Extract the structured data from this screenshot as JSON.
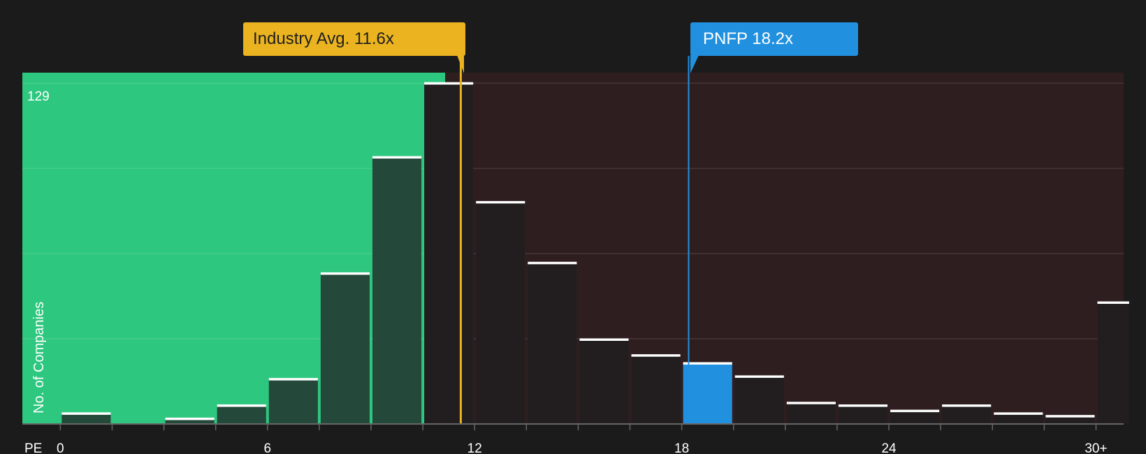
{
  "chart_data": {
    "type": "bar",
    "metric_label": "PE",
    "ylabel": "No. of Companies",
    "ymax_label": "129",
    "ylim": [
      0,
      133
    ],
    "xlim": [
      -1.1,
      30.8
    ],
    "x_ticks": [
      {
        "value": 0,
        "label": "0"
      },
      {
        "value": 6,
        "label": "6"
      },
      {
        "value": 12,
        "label": "12"
      },
      {
        "value": 18,
        "label": "18"
      },
      {
        "value": 24,
        "label": "24"
      },
      {
        "value": 30,
        "label": "30+"
      }
    ],
    "bins": [
      {
        "from": 0.0,
        "to": 1.5,
        "value": 4
      },
      {
        "from": 1.5,
        "to": 3.0,
        "value": 0
      },
      {
        "from": 3.0,
        "to": 4.5,
        "value": 2
      },
      {
        "from": 4.5,
        "to": 6.0,
        "value": 7
      },
      {
        "from": 6.0,
        "to": 7.5,
        "value": 17
      },
      {
        "from": 7.5,
        "to": 9.0,
        "value": 57
      },
      {
        "from": 9.0,
        "to": 10.5,
        "value": 101
      },
      {
        "from": 10.5,
        "to": 12.0,
        "value": 129
      },
      {
        "from": 12.0,
        "to": 13.5,
        "value": 84
      },
      {
        "from": 13.5,
        "to": 15.0,
        "value": 61
      },
      {
        "from": 15.0,
        "to": 16.5,
        "value": 32
      },
      {
        "from": 16.5,
        "to": 18.0,
        "value": 26
      },
      {
        "from": 18.0,
        "to": 19.5,
        "value": 23
      },
      {
        "from": 19.5,
        "to": 21.0,
        "value": 18
      },
      {
        "from": 21.0,
        "to": 22.5,
        "value": 8
      },
      {
        "from": 22.5,
        "to": 24.0,
        "value": 7
      },
      {
        "from": 24.0,
        "to": 25.5,
        "value": 5
      },
      {
        "from": 25.5,
        "to": 27.0,
        "value": 7
      },
      {
        "from": 27.0,
        "to": 28.5,
        "value": 4
      },
      {
        "from": 28.5,
        "to": 30.0,
        "value": 3
      },
      {
        "from": 30.0,
        "to": 31.0,
        "value": 46
      }
    ],
    "highlight_bin_index": 12,
    "industry_avg": {
      "label": "Industry Avg. 11.6x",
      "value": 11.6
    },
    "company": {
      "label": "PNFP 18.2x",
      "value": 18.2
    },
    "colors": {
      "background": "#1b1b1b",
      "below_region": "#2ec77f",
      "above_region": "#2f1e20",
      "bar_in_below": "#24483a",
      "bar_in_above": "#221e1f",
      "bar_cap": "#ffffff",
      "highlight_bar": "#2191df",
      "industry": "#eab31f",
      "company": "#2191df",
      "gridline": "#ffffff"
    }
  }
}
